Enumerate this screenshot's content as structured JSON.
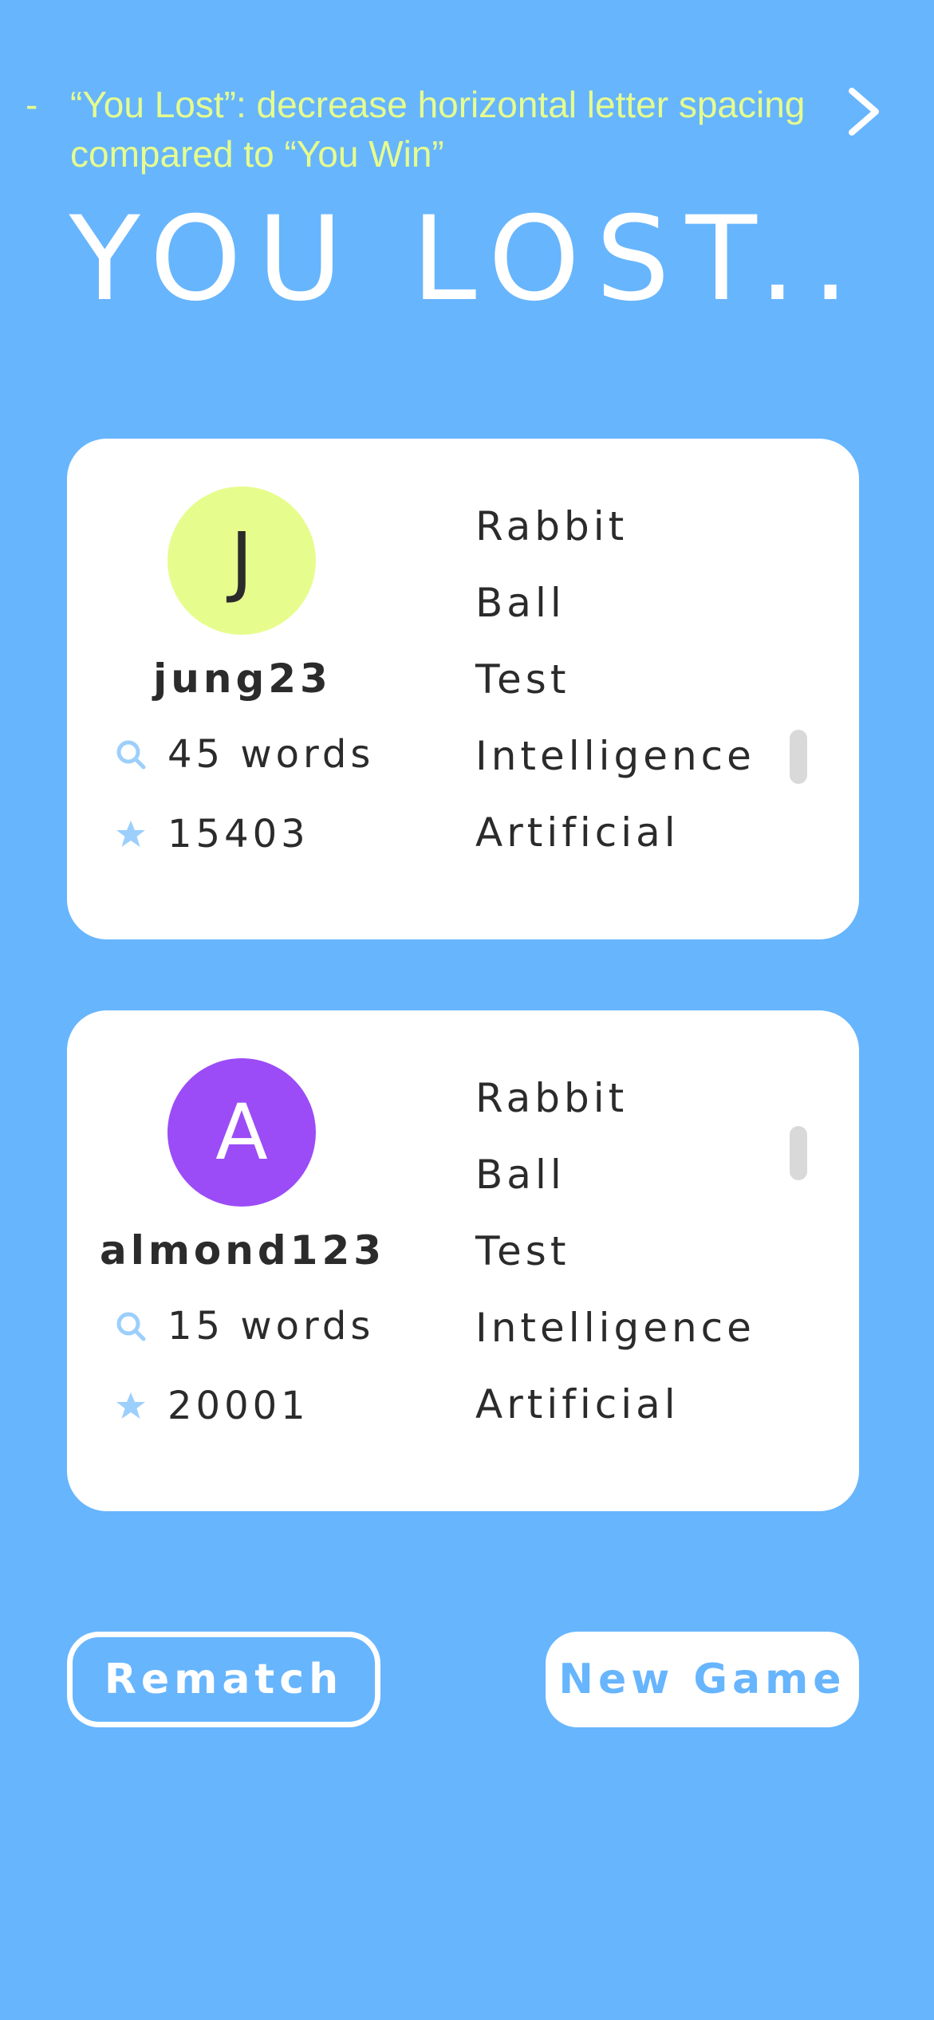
{
  "annotation": {
    "dash": "-",
    "text": "“You Lost”: decrease horizontal letter spacing compared to “You Win”"
  },
  "title": "YOU LOST..",
  "players": [
    {
      "initial": "J",
      "username": "jung23",
      "words_count": "45 words",
      "score": "15403",
      "words": [
        "Rabbit",
        "Ball",
        "Test",
        "Intelligence",
        "Artificial"
      ]
    },
    {
      "initial": "A",
      "username": "almond123",
      "words_count": "15 words",
      "score": "20001",
      "words": [
        "Rabbit",
        "Ball",
        "Test",
        "Intelligence",
        "Artificial"
      ]
    }
  ],
  "buttons": {
    "rematch": "Rematch",
    "new_game": "New Game"
  },
  "colors": {
    "background": "#67b5fd",
    "annotation": "#e6fd8e",
    "avatar_1": "#e6fd8e",
    "avatar_2": "#9b4cf6",
    "icon": "#9ccffc"
  },
  "icons": {
    "chevron": "chevron-right-icon",
    "words": "search-icon",
    "score": "star-icon"
  }
}
